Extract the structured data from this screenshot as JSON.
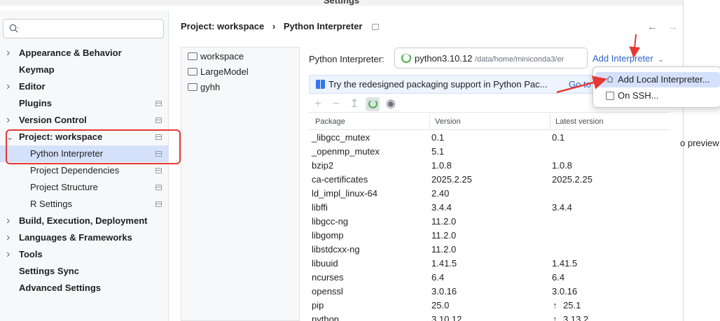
{
  "window": {
    "title": "Settings"
  },
  "search": {
    "placeholder": ""
  },
  "sidebar": {
    "items": [
      {
        "label": "Appearance & Behavior",
        "expandable": true,
        "pinned": false
      },
      {
        "label": "Keymap",
        "expandable": false,
        "pinned": false
      },
      {
        "label": "Editor",
        "expandable": true,
        "pinned": false
      },
      {
        "label": "Plugins",
        "expandable": false,
        "pinned": true
      },
      {
        "label": "Version Control",
        "expandable": true,
        "pinned": true
      },
      {
        "label": "Project: workspace",
        "expandable": true,
        "expanded": true,
        "pinned": true
      },
      {
        "label": "Python Interpreter",
        "sub": true,
        "selected": true,
        "pinned": true
      },
      {
        "label": "Project Dependencies",
        "sub": true,
        "pinned": true
      },
      {
        "label": "Project Structure",
        "sub": true,
        "pinned": true
      },
      {
        "label": "R Settings",
        "sub": true,
        "pinned": true
      },
      {
        "label": "Build, Execution, Deployment",
        "expandable": true,
        "pinned": false
      },
      {
        "label": "Languages & Frameworks",
        "expandable": true,
        "pinned": false
      },
      {
        "label": "Tools",
        "expandable": true,
        "pinned": false
      },
      {
        "label": "Settings Sync",
        "expandable": false,
        "pinned": false
      },
      {
        "label": "Advanced Settings",
        "expandable": false,
        "pinned": false
      }
    ]
  },
  "breadcrumb": {
    "parent": "Project: workspace",
    "separator": "›",
    "current": "Python Interpreter"
  },
  "projects": [
    {
      "label": "workspace",
      "selected": true
    },
    {
      "label": "LargeModel",
      "selected": false
    },
    {
      "label": "gyhh",
      "selected": false
    }
  ],
  "interpreter": {
    "label": "Python Interpreter:",
    "name": "python3.10.12",
    "path": "/data/home/miniconda3/er",
    "add_label": "Add Interpreter"
  },
  "banner": {
    "text": "Try the redesigned packaging support in Python Pac...",
    "link": "Go to"
  },
  "table": {
    "columns": [
      "Package",
      "Version",
      "Latest version"
    ],
    "rows": [
      {
        "package": "_libgcc_mutex",
        "version": "0.1",
        "latest": "0.1",
        "upgrade": false
      },
      {
        "package": "_openmp_mutex",
        "version": "5.1",
        "latest": "",
        "upgrade": false
      },
      {
        "package": "bzip2",
        "version": "1.0.8",
        "latest": "1.0.8",
        "upgrade": false
      },
      {
        "package": "ca-certificates",
        "version": "2025.2.25",
        "latest": "2025.2.25",
        "upgrade": false
      },
      {
        "package": "ld_impl_linux-64",
        "version": "2.40",
        "latest": "",
        "upgrade": false
      },
      {
        "package": "libffi",
        "version": "3.4.4",
        "latest": "3.4.4",
        "upgrade": false
      },
      {
        "package": "libgcc-ng",
        "version": "11.2.0",
        "latest": "",
        "upgrade": false
      },
      {
        "package": "libgomp",
        "version": "11.2.0",
        "latest": "",
        "upgrade": false
      },
      {
        "package": "libstdcxx-ng",
        "version": "11.2.0",
        "latest": "",
        "upgrade": false
      },
      {
        "package": "libuuid",
        "version": "1.41.5",
        "latest": "1.41.5",
        "upgrade": false
      },
      {
        "package": "ncurses",
        "version": "6.4",
        "latest": "6.4",
        "upgrade": false
      },
      {
        "package": "openssl",
        "version": "3.0.16",
        "latest": "3.0.16",
        "upgrade": false
      },
      {
        "package": "pip",
        "version": "25.0",
        "latest": "25.1",
        "upgrade": true
      },
      {
        "package": "python",
        "version": "3.10.12",
        "latest": "3.13.2",
        "upgrade": true
      }
    ]
  },
  "popup": {
    "items": [
      {
        "label": "Add Local Interpreter...",
        "highlighted": true
      },
      {
        "label": "On SSH...",
        "highlighted": false
      }
    ]
  },
  "right_panel": {
    "text": "o preview"
  },
  "colors": {
    "accent": "#2b63c9",
    "selection": "#d5e1fb",
    "annotation": "#e53935"
  }
}
